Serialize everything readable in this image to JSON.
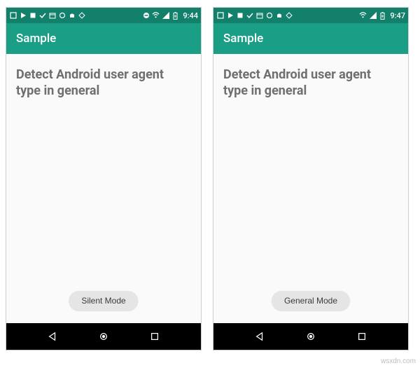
{
  "watermark": "wsxdn.com",
  "phones": [
    {
      "status": {
        "time": "9:44"
      },
      "app_bar": {
        "title": "Sample"
      },
      "content": {
        "heading": "Detect Android user agent type in general",
        "mode_button": "Silent Mode"
      }
    },
    {
      "status": {
        "time": "9:47"
      },
      "app_bar": {
        "title": "Sample"
      },
      "content": {
        "heading": "Detect Android user agent type in general",
        "mode_button": "General Mode"
      }
    }
  ]
}
